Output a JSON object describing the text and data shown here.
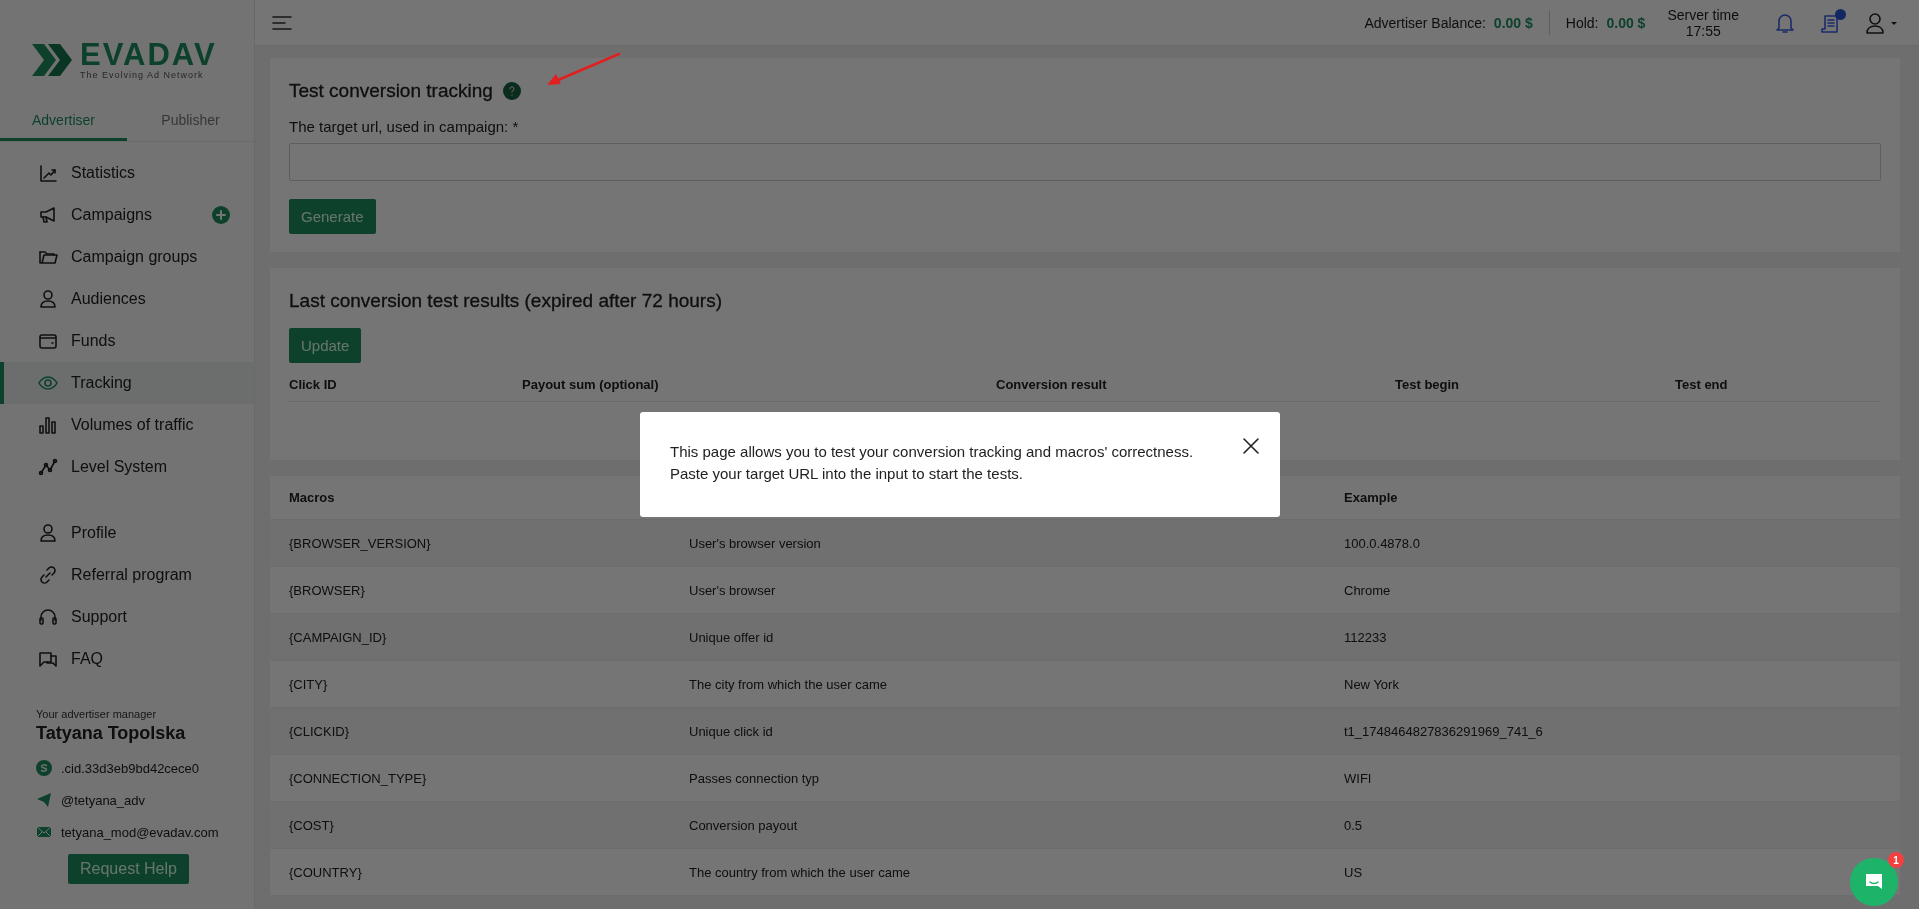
{
  "sidebar": {
    "logo": {
      "name": "EVADAV",
      "tagline": "The Evolving Ad Network"
    },
    "tabs": [
      {
        "label": "Advertiser",
        "selected": true
      },
      {
        "label": "Publisher",
        "selected": false
      }
    ],
    "nav_groups": [
      [
        {
          "label": "Statistics",
          "selected": false
        },
        {
          "label": "Campaigns",
          "selected": false,
          "add_button": true
        },
        {
          "label": "Campaign groups",
          "selected": false
        },
        {
          "label": "Audiences",
          "selected": false
        },
        {
          "label": "Funds",
          "selected": false
        },
        {
          "label": "Tracking",
          "selected": true
        },
        {
          "label": "Volumes of traffic",
          "selected": false
        },
        {
          "label": "Level System",
          "selected": false
        }
      ],
      [
        {
          "label": "Profile",
          "selected": false
        },
        {
          "label": "Referral program",
          "selected": false
        },
        {
          "label": "Support",
          "selected": false
        },
        {
          "label": "FAQ",
          "selected": false
        }
      ]
    ],
    "manager": {
      "caption": "Your advertiser manager",
      "name": "Tatyana Topolska",
      "contacts": [
        {
          "kind": "skype",
          "text": ".cid.33d3eb9bd42cece0"
        },
        {
          "kind": "telegram",
          "text": "@tetyana_adv"
        },
        {
          "kind": "email",
          "text": "tetyana_mod@evadav.com"
        }
      ]
    },
    "button": "Request Help"
  },
  "header": {
    "balance_label": "Advertiser Balance:",
    "balance_value": "0.00 $",
    "hold_label": "Hold:",
    "hold_value": "0.00 $",
    "server_time_label": "Server time",
    "server_time": "17:55",
    "news_unread": true
  },
  "test_card": {
    "title": "Test conversion tracking",
    "field_label": "The target url, used in campaign: *",
    "button": "Generate"
  },
  "results_card": {
    "title": "Last conversion test results (expired after 72 hours)",
    "button": "Update",
    "columns": [
      "Click ID",
      "Payout sum (optional)",
      "Conversion result",
      "Test begin",
      "Test end"
    ]
  },
  "macros_table": {
    "columns": [
      "Macros",
      null,
      "Example"
    ],
    "rows": [
      {
        "macro": "{BROWSER_VERSION}",
        "description": "User's browser version",
        "example": "100.0.4878.0"
      },
      {
        "macro": "{BROWSER}",
        "description": "User's browser",
        "example": "Chrome"
      },
      {
        "macro": "{CAMPAIGN_ID}",
        "description": "Unique offer id",
        "example": "112233"
      },
      {
        "macro": "{CITY}",
        "description": "The city from which the user came",
        "example": "New York"
      },
      {
        "macro": "{CLICKID}",
        "description": "Unique click id",
        "example": "t1_1748464827836291969_741_6"
      },
      {
        "macro": "{CONNECTION_TYPE}",
        "description": "Passes connection typ",
        "example": "WIFI"
      },
      {
        "macro": "{COST}",
        "description": "Conversion payout",
        "example": "0.5"
      },
      {
        "macro": "{COUNTRY}",
        "description": "The country from which the user came",
        "example": "US"
      }
    ]
  },
  "modal": {
    "lines": [
      "This page allows you to test your conversion tracking and macros' correctness.",
      "Paste your target URL into the input to start the tests."
    ]
  },
  "chat": {
    "badge": "1"
  }
}
